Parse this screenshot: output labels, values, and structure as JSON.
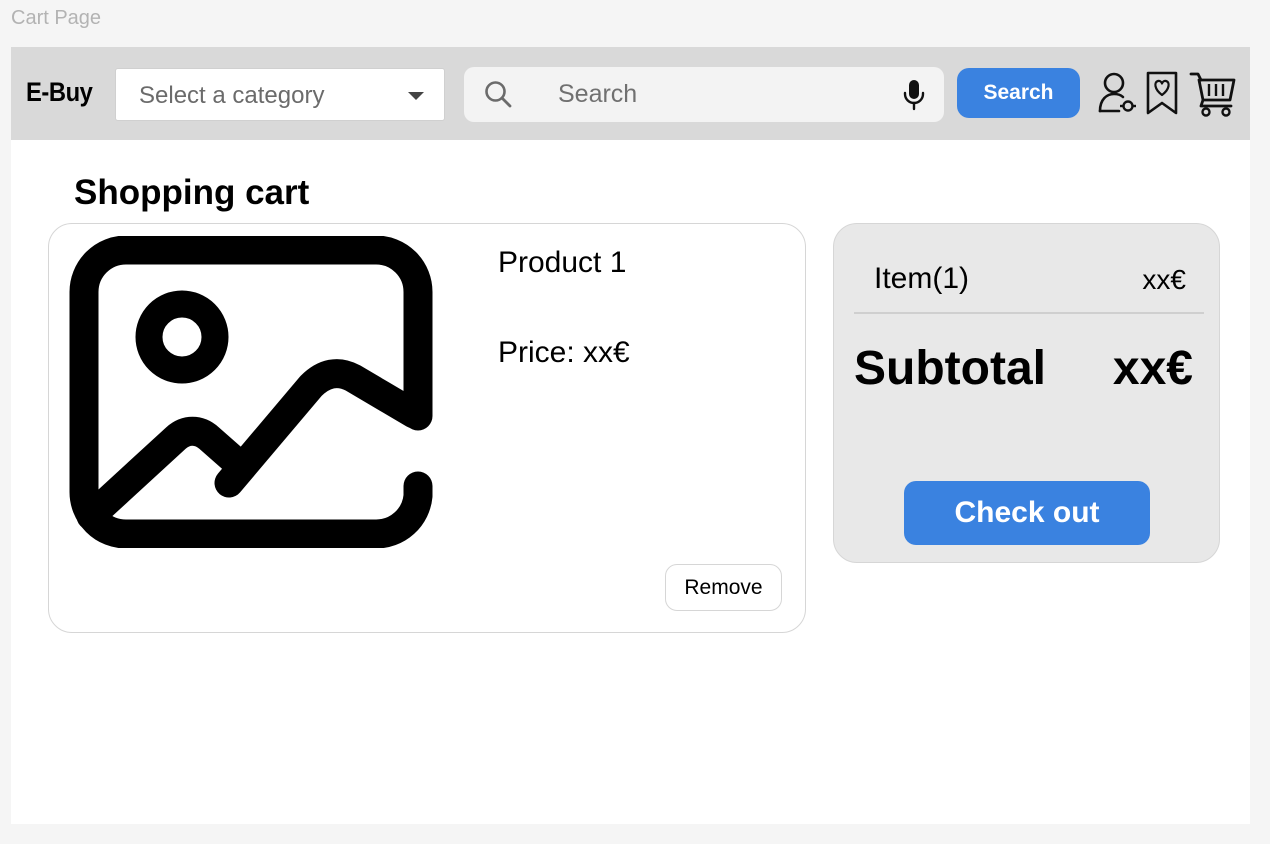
{
  "frame_label": "Cart Page",
  "colors": {
    "accent": "#3a82e0",
    "navbar_bg": "#d9d9d9",
    "summary_bg": "#e8e8e8"
  },
  "navbar": {
    "logo": "E-Buy",
    "category_select": {
      "value": "Select a category",
      "icon": "chevron-down-icon"
    },
    "search": {
      "placeholder": "Search",
      "icon": "search-icon",
      "mic_icon": "microphone-icon"
    },
    "search_button": "Search",
    "icons": [
      "user-icon",
      "wishlist-icon",
      "cart-icon"
    ]
  },
  "page_title": "Shopping cart",
  "cart_items": [
    {
      "image_icon": "image-placeholder-icon",
      "name": "Product 1",
      "price": "Price: xx€",
      "remove_label": "Remove"
    }
  ],
  "summary": {
    "item_label": "Item(1)",
    "item_value": "xx€",
    "subtotal_label": "Subtotal",
    "subtotal_value": "xx€",
    "checkout_label": "Check out"
  }
}
